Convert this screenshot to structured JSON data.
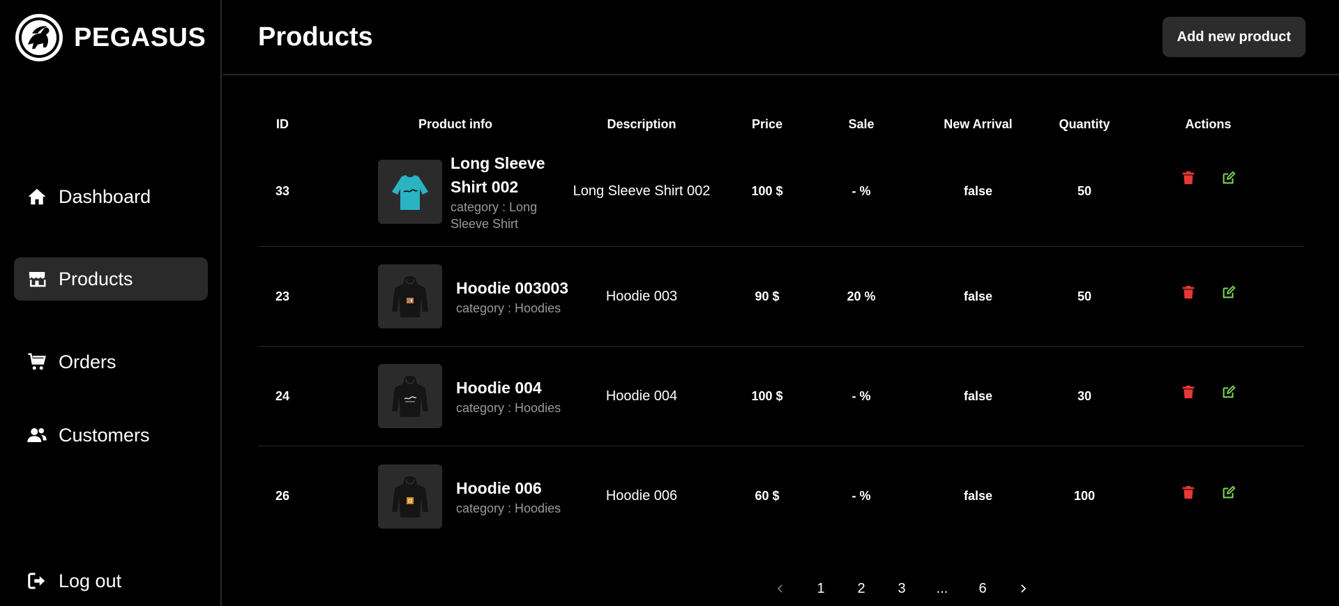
{
  "brand": {
    "name": "PEGASUS"
  },
  "sidebar": {
    "items": [
      {
        "label": "Dashboard",
        "icon": "home-icon"
      },
      {
        "label": "Products",
        "icon": "store-icon",
        "active": true
      },
      {
        "label": "Orders",
        "icon": "cart-icon"
      },
      {
        "label": "Customers",
        "icon": "users-icon"
      }
    ],
    "logout": {
      "label": "Log out",
      "icon": "logout-icon"
    }
  },
  "header": {
    "title": "Products",
    "add_button": "Add new product"
  },
  "table": {
    "columns": [
      "ID",
      "Product info",
      "Description",
      "Price",
      "Sale",
      "New Arrival",
      "Quantity",
      "Actions"
    ],
    "rows": [
      {
        "id": "33",
        "title": "Long Sleeve Shirt 002",
        "category": "category : Long Sleeve Shirt",
        "description": "Long Sleeve Shirt 002",
        "price": "100 $",
        "sale": "- %",
        "new_arrival": "false",
        "quantity": "50",
        "thumb_color": "#2bb3c4"
      },
      {
        "id": "23",
        "title": "Hoodie 003003",
        "category": "category : Hoodies",
        "description": "Hoodie 003",
        "price": "90 $",
        "sale": "20 %",
        "new_arrival": "false",
        "quantity": "50",
        "thumb_color": "#1b1b1b"
      },
      {
        "id": "24",
        "title": "Hoodie 004",
        "category": "category : Hoodies",
        "description": "Hoodie 004",
        "price": "100 $",
        "sale": "- %",
        "new_arrival": "false",
        "quantity": "30",
        "thumb_color": "#1b1b1b"
      },
      {
        "id": "26",
        "title": "Hoodie 006",
        "category": "category : Hoodies",
        "description": "Hoodie 006",
        "price": "60 $",
        "sale": "- %",
        "new_arrival": "false",
        "quantity": "100",
        "thumb_color": "#1b1b1b"
      }
    ]
  },
  "pagination": {
    "pages": [
      "1",
      "2",
      "3",
      "...",
      "6"
    ]
  },
  "colors": {
    "delete": "#e53935",
    "edit": "#7ed957",
    "accent_bg": "#2a2a2a"
  }
}
